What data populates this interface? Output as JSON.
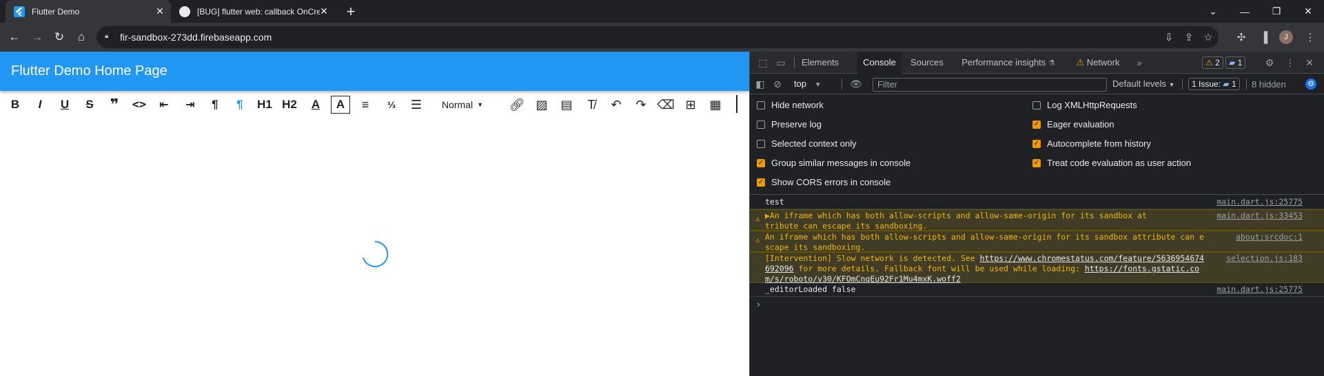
{
  "browser": {
    "tabs": [
      {
        "title": "Flutter Demo",
        "active": true
      },
      {
        "title": "[BUG] flutter web: callback OnCre",
        "active": false
      }
    ],
    "new_tab_label": "+",
    "url": "fir-sandbox-273dd.firebaseapp.com",
    "profile_initial": "J"
  },
  "app": {
    "title": "Flutter Demo Home Page",
    "toolbar": {
      "buttons": [
        "B",
        "I",
        "U",
        "S",
        "❞",
        "<>",
        "⇤",
        "⇥",
        "¶",
        "¶",
        "H1",
        "H2",
        "A",
        "A",
        "≡",
        "⅓",
        "☰"
      ],
      "style_select": "Normal"
    }
  },
  "devtools": {
    "tabs": [
      "Elements",
      "Console",
      "Sources",
      "Performance insights",
      "Network"
    ],
    "active_tab": "Console",
    "warnings_count": "2",
    "messages_count": "1",
    "context": "top",
    "filter_placeholder": "Filter",
    "levels": "Default levels",
    "issues_label": "1 Issue:",
    "issues_count": "1",
    "hidden_label": "8 hidden",
    "settings_left": [
      {
        "label": "Hide network",
        "checked": false
      },
      {
        "label": "Preserve log",
        "checked": false
      },
      {
        "label": "Selected context only",
        "checked": false
      },
      {
        "label": "Group similar messages in console",
        "checked": true
      },
      {
        "label": "Show CORS errors in console",
        "checked": true
      }
    ],
    "settings_right": [
      {
        "label": "Log XMLHttpRequests",
        "checked": false
      },
      {
        "label": "Eager evaluation",
        "checked": true
      },
      {
        "label": "Autocomplete from history",
        "checked": true
      },
      {
        "label": "Treat code evaluation as user action",
        "checked": true
      }
    ],
    "console": [
      {
        "kind": "log",
        "text": "test",
        "source": "main.dart.js:25775"
      },
      {
        "kind": "warn",
        "text": "▶An iframe which has both allow-scripts and allow-same-origin for its sandbox attribute can escape its sandboxing.",
        "source": "main.dart.js:33453"
      },
      {
        "kind": "warn",
        "text": "An iframe which has both allow-scripts and allow-same-origin for its sandbox attribute can escape its sandboxing.",
        "source": "about:srcdoc:1"
      },
      {
        "kind": "warn",
        "text_before": "[Intervention] Slow network is detected. See ",
        "link1": "https://www.chromestatus.com/feature/5636954674692096",
        "text_mid": " for more details. Fallback font will be used while loading: ",
        "link2": "https://fonts.gstatic.com/s/roboto/v30/KFOmCnqEu92Fr1Mu4mxK.woff2",
        "source": "selection.js:183"
      },
      {
        "kind": "log",
        "text": "_editorLoaded false",
        "source": "main.dart.js:25775"
      }
    ],
    "prompt": "›"
  }
}
